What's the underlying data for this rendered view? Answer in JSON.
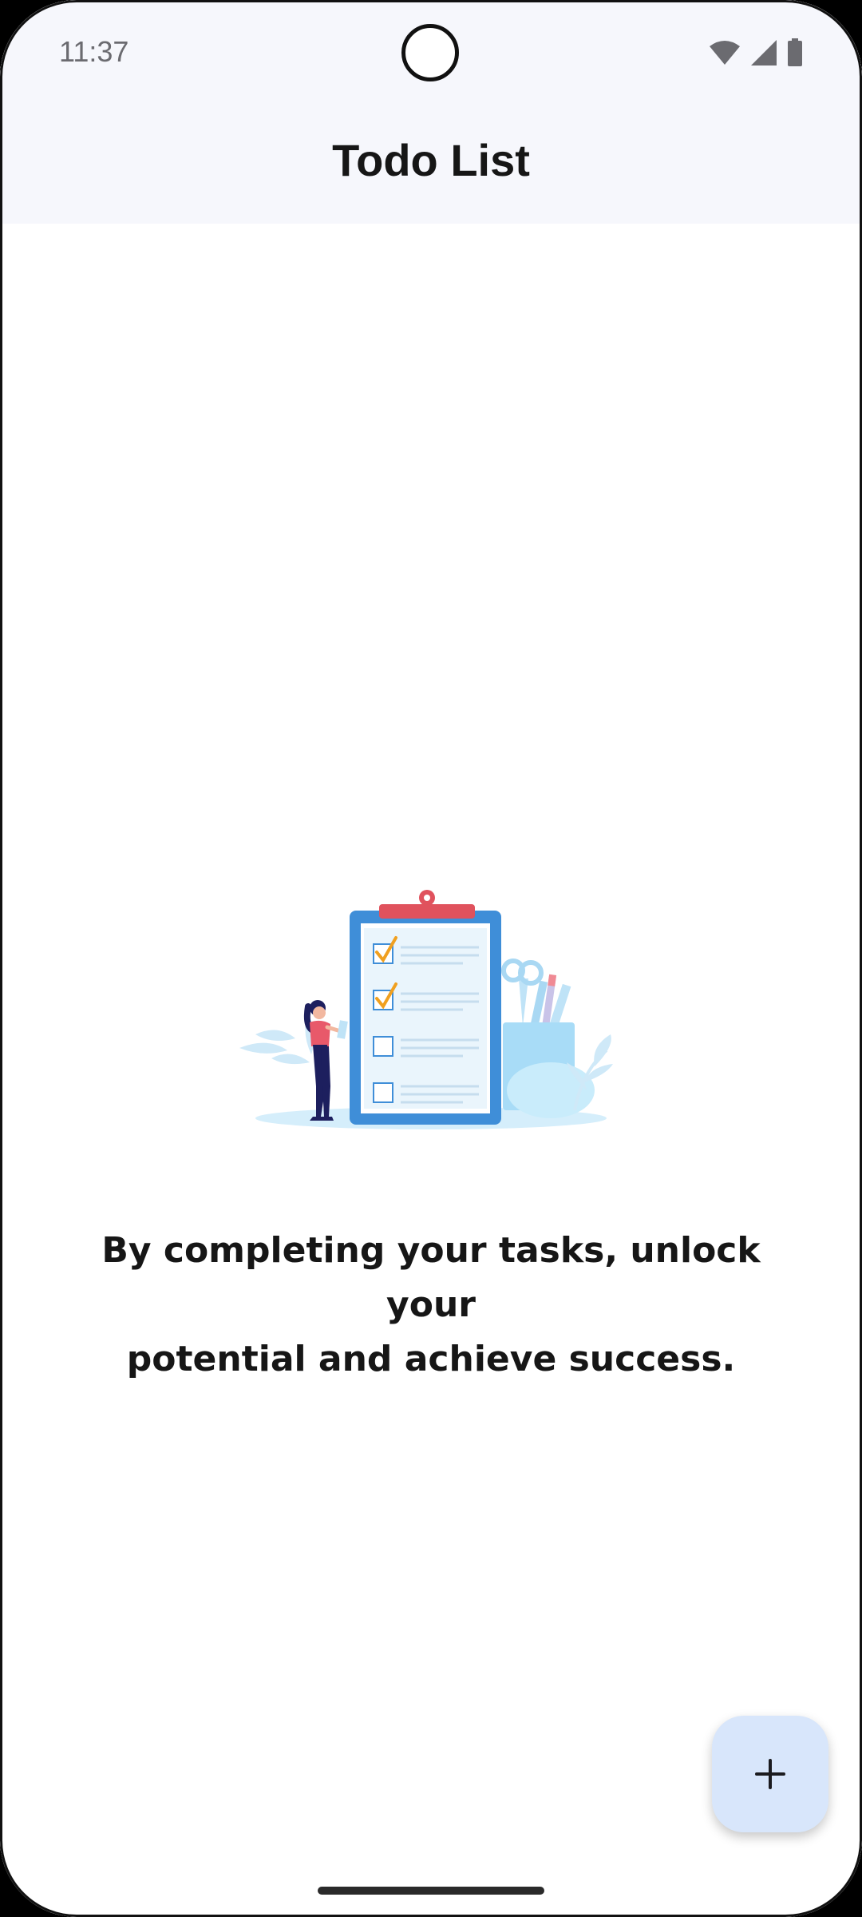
{
  "status_bar": {
    "time": "11:37",
    "icons": [
      "wifi-icon",
      "signal-icon",
      "battery-icon"
    ]
  },
  "header": {
    "title": "Todo List"
  },
  "empty_state": {
    "illustration": "clipboard-checklist-illustration",
    "message_line1": "By completing your tasks, unlock your",
    "message_line2": "potential and achieve success."
  },
  "fab": {
    "icon": "plus-icon",
    "color": "#d8e6fb"
  },
  "colors": {
    "header_bg": "#f6f7fc",
    "text": "#161616",
    "accent_blue": "#3f8ed8",
    "clip_red": "#e0525d",
    "check_orange": "#f0a020"
  }
}
